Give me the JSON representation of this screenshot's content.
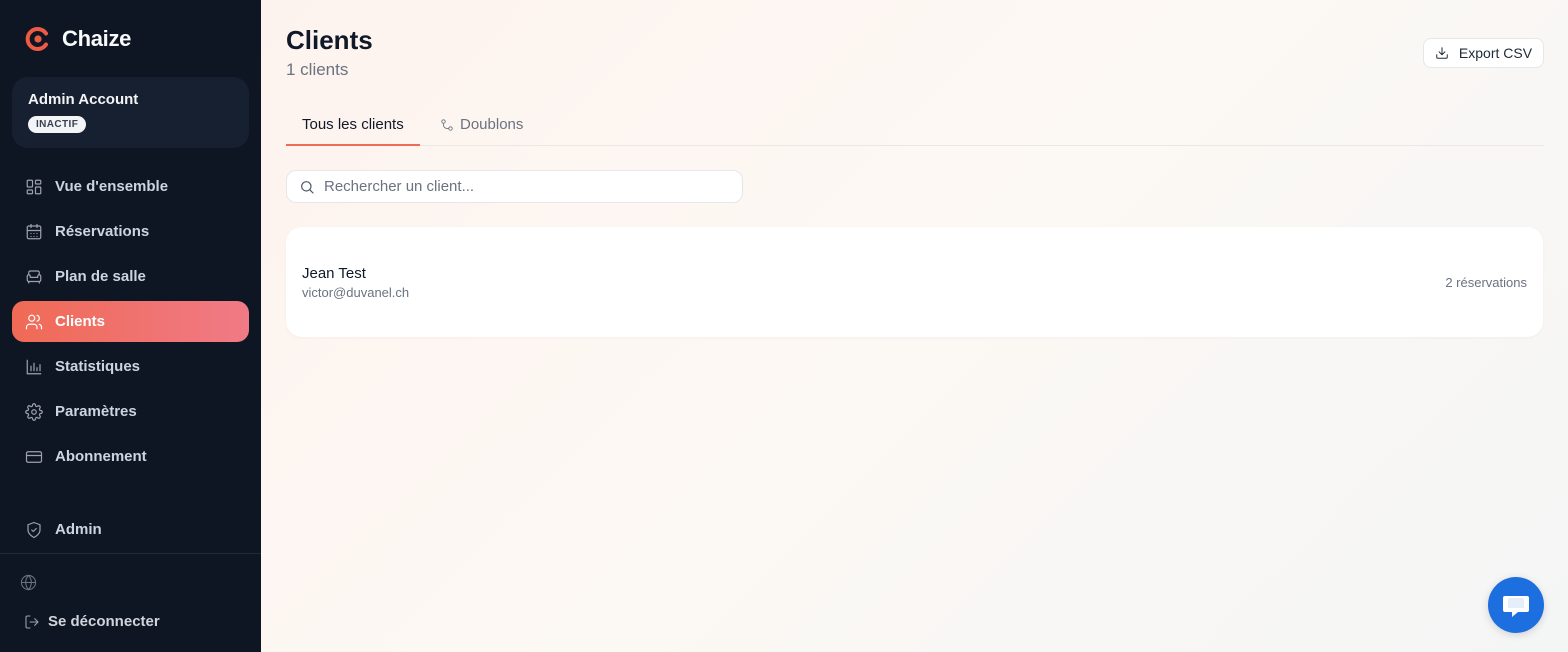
{
  "brand": {
    "name": "Chaize",
    "accent": "#ee5a43"
  },
  "account": {
    "name": "Admin Account",
    "status_badge": "INACTIF"
  },
  "nav": {
    "items": [
      {
        "label": "Vue d'ensemble",
        "icon": "dashboard-icon",
        "active": false
      },
      {
        "label": "Réservations",
        "icon": "calendar-icon",
        "active": false
      },
      {
        "label": "Plan de salle",
        "icon": "armchair-icon",
        "active": false
      },
      {
        "label": "Clients",
        "icon": "users-icon",
        "active": true
      },
      {
        "label": "Statistiques",
        "icon": "bar-chart-icon",
        "active": false
      },
      {
        "label": "Paramètres",
        "icon": "gear-icon",
        "active": false
      },
      {
        "label": "Abonnement",
        "icon": "credit-card-icon",
        "active": false
      }
    ],
    "admin_label": "Admin",
    "logout_label": "Se déconnecter"
  },
  "header": {
    "title": "Clients",
    "subtitle": "1 clients",
    "export_label": "Export CSV"
  },
  "tabs": [
    {
      "label": "Tous les clients",
      "active": true
    },
    {
      "label": "Doublons",
      "active": false
    }
  ],
  "search": {
    "placeholder": "Rechercher un client...",
    "value": ""
  },
  "clients": [
    {
      "name": "Jean Test",
      "email": "victor@duvanel.ch",
      "reservations": "2 réservations"
    }
  ],
  "colors": {
    "sidebar_bg": "#0f1623",
    "active_gradient_start": "#f06a55",
    "active_gradient_end": "#f07a86",
    "chat_button": "#1d6fe0"
  }
}
